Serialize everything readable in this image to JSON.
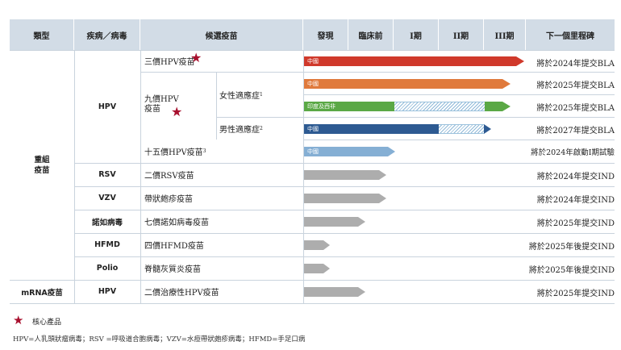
{
  "header": {
    "type": "類型",
    "disease": "疾病／病毒",
    "candidate": "候選疫苗",
    "discovery": "發現",
    "preclinical": "臨床前",
    "phase1": "I期",
    "phase2": "II期",
    "phase3": "III期",
    "milestone": "下一個里程碑"
  },
  "groups": {
    "recombinant": "重組\n疫苗",
    "mrna": "mRNA疫苗"
  },
  "diseases": {
    "hpv": "HPV",
    "rsv": "RSV",
    "vzv": "VZV",
    "norovirus": "諾如病毒",
    "hfmd": "HFMD",
    "polio": "Polio",
    "mrna_hpv": "HPV"
  },
  "candidates": {
    "hpv3": "三價HPV疫苗",
    "hpv9": "九價HPV\n疫苗",
    "hpv9_female": "女性適應症",
    "hpv9_female_sup": "1",
    "hpv9_male": "男性適應症",
    "hpv9_male_sup": "2",
    "hpv15": "十五價HPV疫苗",
    "hpv15_sup": "3",
    "rsv": "二價RSV疫苗",
    "vzv": "帶狀皰疹疫苗",
    "noro": "七價諾如病毒疫苗",
    "hfmd": "四價HFMD疫苗",
    "polio": "脊髓灰質炎疫苗",
    "mrna_hpv": "二價治療性HPV疫苗"
  },
  "bar_labels": {
    "china": "中國",
    "india": "印度及西非"
  },
  "milestones": {
    "hpv3": "將於2024年提交BLA",
    "hpv9_female_cn": "將於2025年提交BLA",
    "hpv9_female_in": "將於2025年提交BLA",
    "hpv9_male": "將於2027年提交BLA",
    "hpv15": "將於2024年啟動I期試驗",
    "rsv": "將於2024年提交IND",
    "vzv": "將於2024年提交IND",
    "noro": "將於2025年提交IND",
    "hfmd": "將於2025年後提交IND",
    "polio": "將於2025年後提交IND",
    "mrna_hpv": "將於2025年提交IND"
  },
  "colors": {
    "header_bg": "#d2dce6",
    "red": "#d0392b",
    "orange": "#e07a3c",
    "green": "#5aa845",
    "blue": "#2d5a92",
    "lightblue": "#85afd4",
    "gray": "#adadad",
    "star": "#a8102e"
  },
  "legend": {
    "core_product": "核心產品"
  },
  "footnote": "HPV=人乳頭狀瘤病毒；RSV =呼吸道合胞病毒；VZV=水痘帶狀皰疹病毒；HFMD=手足口病"
}
